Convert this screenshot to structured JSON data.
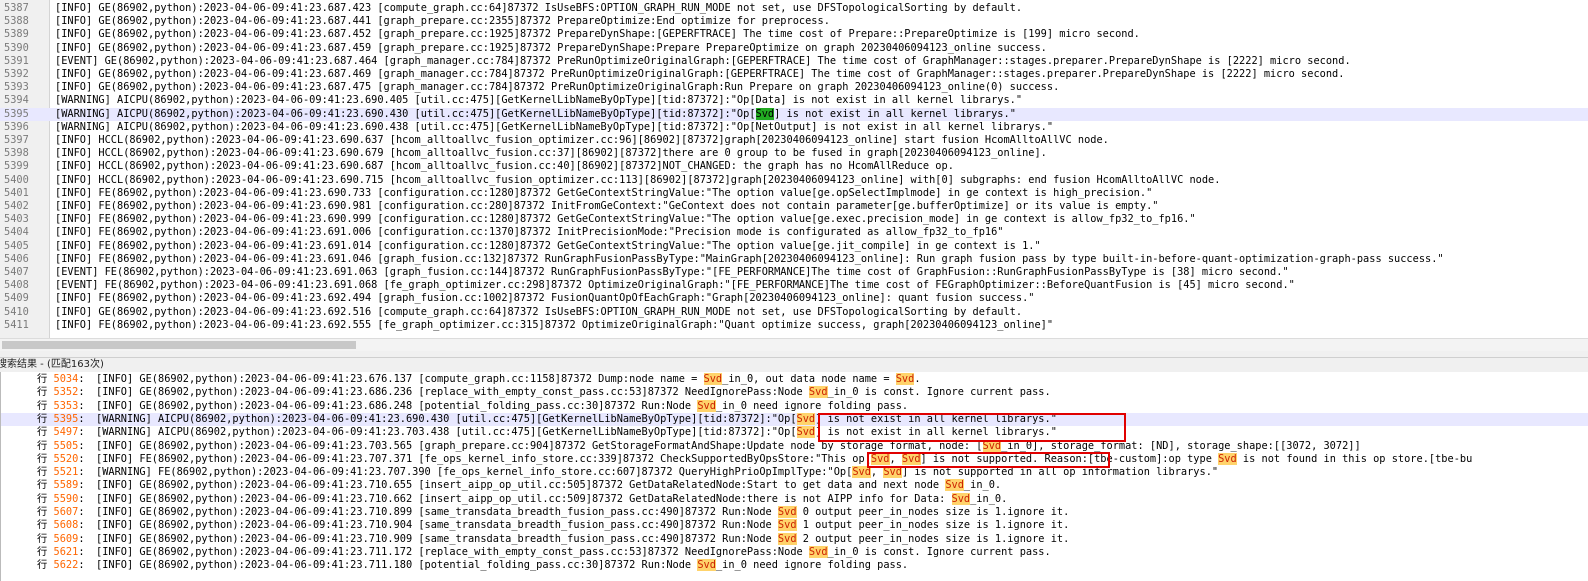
{
  "editor": {
    "lines": [
      {
        "num": "5387",
        "pre": "[INFO] GE(86902,python):2023-04-06-09:41:23.687.423 [compute_graph.cc:64]87372 IsUseBFS:OPTION_GRAPH_RUN_MODE not set, use DFSTopologicalSorting by default."
      },
      {
        "num": "5388",
        "pre": "[INFO] GE(86902,python):2023-04-06-09:41:23.687.441 [graph_prepare.cc:2355]87372 PrepareOptimize:End optimize for preprocess."
      },
      {
        "num": "5389",
        "pre": "[INFO] GE(86902,python):2023-04-06-09:41:23.687.452 [graph_prepare.cc:1925]87372 PrepareDynShape:[GEPERFTRACE] The time cost of Prepare::PrepareOptimize is [199] micro second."
      },
      {
        "num": "5390",
        "pre": "[INFO] GE(86902,python):2023-04-06-09:41:23.687.459 [graph_prepare.cc:1925]87372 PrepareDynShape:Prepare PrepareOptimize on graph 20230406094123_online success."
      },
      {
        "num": "5391",
        "pre": "[EVENT] GE(86902,python):2023-04-06-09:41:23.687.464 [graph_manager.cc:784]87372 PreRunOptimizeOriginalGraph:[GEPERFTRACE] The time cost of GraphManager::stages.preparer.PrepareDynShape is [2222] micro second."
      },
      {
        "num": "5392",
        "pre": "[INFO] GE(86902,python):2023-04-06-09:41:23.687.469 [graph_manager.cc:784]87372 PreRunOptimizeOriginalGraph:[GEPERFTRACE] The time cost of GraphManager::stages.preparer.PrepareDynShape is [2222] micro second."
      },
      {
        "num": "5393",
        "pre": "[INFO] GE(86902,python):2023-04-06-09:41:23.687.475 [graph_manager.cc:784]87372 PreRunOptimizeOriginalGraph:Run Prepare on graph 20230406094123_online(0) success."
      },
      {
        "num": "5394",
        "pre": "[WARNING] AICPU(86902,python):2023-04-06-09:41:23.690.405 [util.cc:475][GetKernelLibNameByOpType][tid:87372]:\"Op[Data] is not exist in all kernel librarys.\""
      },
      {
        "num": "5395",
        "pre": "[WARNING] AICPU(86902,python):2023-04-06-09:41:23.690.430 [util.cc:475][GetKernelLibNameByOpType][tid:87372]:\"Op[",
        "hl": "Svd",
        "post": "] is not exist in all kernel librarys.\"",
        "current": true
      },
      {
        "num": "5396",
        "pre": "[WARNING] AICPU(86902,python):2023-04-06-09:41:23.690.438 [util.cc:475][GetKernelLibNameByOpType][tid:87372]:\"Op[NetOutput] is not exist in all kernel librarys.\""
      },
      {
        "num": "5397",
        "pre": "[INFO] HCCL(86902,python):2023-04-06-09:41:23.690.637 [hcom_alltoallvc_fusion_optimizer.cc:96][86902][87372]graph[20230406094123_online] start fusion HcomAlltoAllVC node."
      },
      {
        "num": "5398",
        "pre": "[INFO] HCCL(86902,python):2023-04-06-09:41:23.690.679 [hcom_alltoallvc_fusion.cc:37][86902][87372]there are 0 group to be fused in graph[20230406094123_online]."
      },
      {
        "num": "5399",
        "pre": "[INFO] HCCL(86902,python):2023-04-06-09:41:23.690.687 [hcom_alltoallvc_fusion.cc:40][86902][87372]NOT_CHANGED: the graph has no HcomAllReduce op."
      },
      {
        "num": "5400",
        "pre": "[INFO] HCCL(86902,python):2023-04-06-09:41:23.690.715 [hcom_alltoallvc_fusion_optimizer.cc:113][86902][87372]graph[20230406094123_online] with[0] subgraphs: end fusion HcomAlltoAllVC node."
      },
      {
        "num": "5401",
        "pre": "[INFO] FE(86902,python):2023-04-06-09:41:23.690.733 [configuration.cc:1280]87372 GetGeContextStringValue:\"The option value[ge.opSelectImplmode] in ge context is high_precision.\""
      },
      {
        "num": "5402",
        "pre": "[INFO] FE(86902,python):2023-04-06-09:41:23.690.981 [configuration.cc:280]87372 InitFromGeContext:\"GeContext does not contain parameter[ge.bufferOptimize] or its value is empty.\""
      },
      {
        "num": "5403",
        "pre": "[INFO] FE(86902,python):2023-04-06-09:41:23.690.999 [configuration.cc:1280]87372 GetGeContextStringValue:\"The option value[ge.exec.precision_mode] in ge context is allow_fp32_to_fp16.\""
      },
      {
        "num": "5404",
        "pre": "[INFO] FE(86902,python):2023-04-06-09:41:23.691.006 [configuration.cc:1370]87372 InitPrecisionMode:\"Precision mode is configurated as allow_fp32_to_fp16\""
      },
      {
        "num": "5405",
        "pre": "[INFO] FE(86902,python):2023-04-06-09:41:23.691.014 [configuration.cc:1280]87372 GetGeContextStringValue:\"The option value[ge.jit_compile] in ge context is 1.\""
      },
      {
        "num": "5406",
        "pre": "[INFO] FE(86902,python):2023-04-06-09:41:23.691.046 [graph_fusion.cc:132]87372 RunGraphFusionPassByType:\"MainGraph[20230406094123_online]: Run graph fusion pass by type built-in-before-quant-optimization-graph-pass success.\""
      },
      {
        "num": "5407",
        "pre": "[EVENT] FE(86902,python):2023-04-06-09:41:23.691.063 [graph_fusion.cc:144]87372 RunGraphFusionPassByType:\"[FE_PERFORMANCE]The time cost of GraphFusion::RunGraphFusionPassByType is [38] micro second.\""
      },
      {
        "num": "5408",
        "pre": "[EVENT] FE(86902,python):2023-04-06-09:41:23.691.068 [fe_graph_optimizer.cc:298]87372 OptimizeOriginalGraph:\"[FE_PERFORMANCE]The time cost of FEGraphOptimizer::BeforeQuantFusion is [45] micro second.\""
      },
      {
        "num": "5409",
        "pre": "[INFO] FE(86902,python):2023-04-06-09:41:23.692.494 [graph_fusion.cc:1002]87372 FusionQuantOpOfEachGraph:\"Graph[20230406094123_online]: quant fusion success.\""
      },
      {
        "num": "5410",
        "pre": "[INFO] GE(86902,python):2023-04-06-09:41:23.692.516 [compute_graph.cc:64]87372 IsUseBFS:OPTION_GRAPH_RUN_MODE not set, use DFSTopologicalSorting by default."
      },
      {
        "num": "5411",
        "pre": "[INFO] FE(86902,python):2023-04-06-09:41:23.692.555 [fe_graph_optimizer.cc:315]87372 OptimizeOriginalGraph:\"Quant optimize success, graph[20230406094123_online]\""
      }
    ]
  },
  "results": {
    "title": "搜索结果 - (匹配163次)",
    "row_label": "行",
    "rows": [
      {
        "num": "5034",
        "segs": [
          "[INFO] GE(86902,python):2023-04-06-09:41:23.676.137 [compute_graph.cc:1158]87372 Dump:node name = ",
          {
            "h": "Svd"
          },
          "_in_0, out data node name = ",
          {
            "h": "Svd"
          },
          "."
        ]
      },
      {
        "num": "5352",
        "segs": [
          "[INFO] GE(86902,python):2023-04-06-09:41:23.686.236 [replace_with_empty_const_pass.cc:53]87372 NeedIgnorePass:Node ",
          {
            "h": "Svd"
          },
          "_in_0 is const. Ignore current pass."
        ]
      },
      {
        "num": "5353",
        "segs": [
          "[INFO] GE(86902,python):2023-04-06-09:41:23.686.248 [potential_folding_pass.cc:30]87372 Run:Node ",
          {
            "h": "Svd"
          },
          "_in_0 need ignore folding pass."
        ]
      },
      {
        "num": "5395",
        "selected": true,
        "segs": [
          "[WARNING] AICPU(86902,python):2023-04-06-09:41:23.690.430 [util.cc:475][GetKernelLibNameByOpType][tid:87372]:\"Op[",
          {
            "h": "Svd"
          },
          "] is not exist in all kernel librarys.\""
        ]
      },
      {
        "num": "5497",
        "segs": [
          "[WARNING] AICPU(86902,python):2023-04-06-09:41:23.703.438 [util.cc:475][GetKernelLibNameByOpType][tid:87372]:\"Op[",
          {
            "h": "Svd"
          },
          "] is not exist in all kernel librarys.\""
        ]
      },
      {
        "num": "5505",
        "segs": [
          "[INFO] GE(86902,python):2023-04-06-09:41:23.703.565 [graph_prepare.cc:904]87372 GetStorageFormatAndShape:Update node by storage format, node: [",
          {
            "h": "Svd"
          },
          "_in_0], storage_format: [ND], storage_shape:[[3072, 3072]]"
        ]
      },
      {
        "num": "5520",
        "segs": [
          "[INFO] FE(86902,python):2023-04-06-09:41:23.707.371 [fe_ops_kernel_info_store.cc:339]87372 CheckSupportedByOpsStore:\"This op[",
          {
            "h": "Svd"
          },
          ", ",
          {
            "h": "Svd"
          },
          "] is not supported. Reason:[tbe-custom]:op type ",
          {
            "h": "Svd"
          },
          " is not found in this op store.[tbe-bu"
        ]
      },
      {
        "num": "5521",
        "segs": [
          "[WARNING] FE(86902,python):2023-04-06-09:41:23.707.390 [fe_ops_kernel_info_store.cc:607]87372 QueryHighPrioOpImplType:\"Op[",
          {
            "h": "Svd"
          },
          ", ",
          {
            "h": "Svd"
          },
          "] is not supported in all op information librarys.\""
        ]
      },
      {
        "num": "5589",
        "segs": [
          "[INFO] GE(86902,python):2023-04-06-09:41:23.710.655 [insert_aipp_op_util.cc:505]87372 GetDataRelatedNode:Start to get data and next node ",
          {
            "h": "Svd"
          },
          "_in_0."
        ]
      },
      {
        "num": "5590",
        "segs": [
          "[INFO] GE(86902,python):2023-04-06-09:41:23.710.662 [insert_aipp_op_util.cc:509]87372 GetDataRelatedNode:there is not AIPP info for Data: ",
          {
            "h": "Svd"
          },
          "_in_0."
        ]
      },
      {
        "num": "5607",
        "segs": [
          "[INFO] GE(86902,python):2023-04-06-09:41:23.710.899 [same_transdata_breadth_fusion_pass.cc:490]87372 Run:Node ",
          {
            "h": "Svd"
          },
          " 0 output peer_in_nodes size is 1.ignore it."
        ]
      },
      {
        "num": "5608",
        "segs": [
          "[INFO] GE(86902,python):2023-04-06-09:41:23.710.904 [same_transdata_breadth_fusion_pass.cc:490]87372 Run:Node ",
          {
            "h": "Svd"
          },
          " 1 output peer_in_nodes size is 1.ignore it."
        ]
      },
      {
        "num": "5609",
        "segs": [
          "[INFO] GE(86902,python):2023-04-06-09:41:23.710.909 [same_transdata_breadth_fusion_pass.cc:490]87372 Run:Node ",
          {
            "h": "Svd"
          },
          " 2 output peer_in_nodes size is 1.ignore it."
        ]
      },
      {
        "num": "5621",
        "segs": [
          "[INFO] GE(86902,python):2023-04-06-09:41:23.711.172 [replace_with_empty_const_pass.cc:53]87372 NeedIgnorePass:Node ",
          {
            "h": "Svd"
          },
          "_in_0 is const. Ignore current pass."
        ]
      },
      {
        "num": "5622",
        "segs": [
          "[INFO] GE(86902,python):2023-04-06-09:41:23.711.180 [potential_folding_pass.cc:30]87372 Run:Node ",
          {
            "h": "Svd"
          },
          "_in_0 need ignore folding pass."
        ]
      }
    ]
  },
  "colors": {
    "match_highlight": "#ffd36b",
    "current_line_highlight": "#22aa22",
    "annotation_box": "#e00000"
  }
}
